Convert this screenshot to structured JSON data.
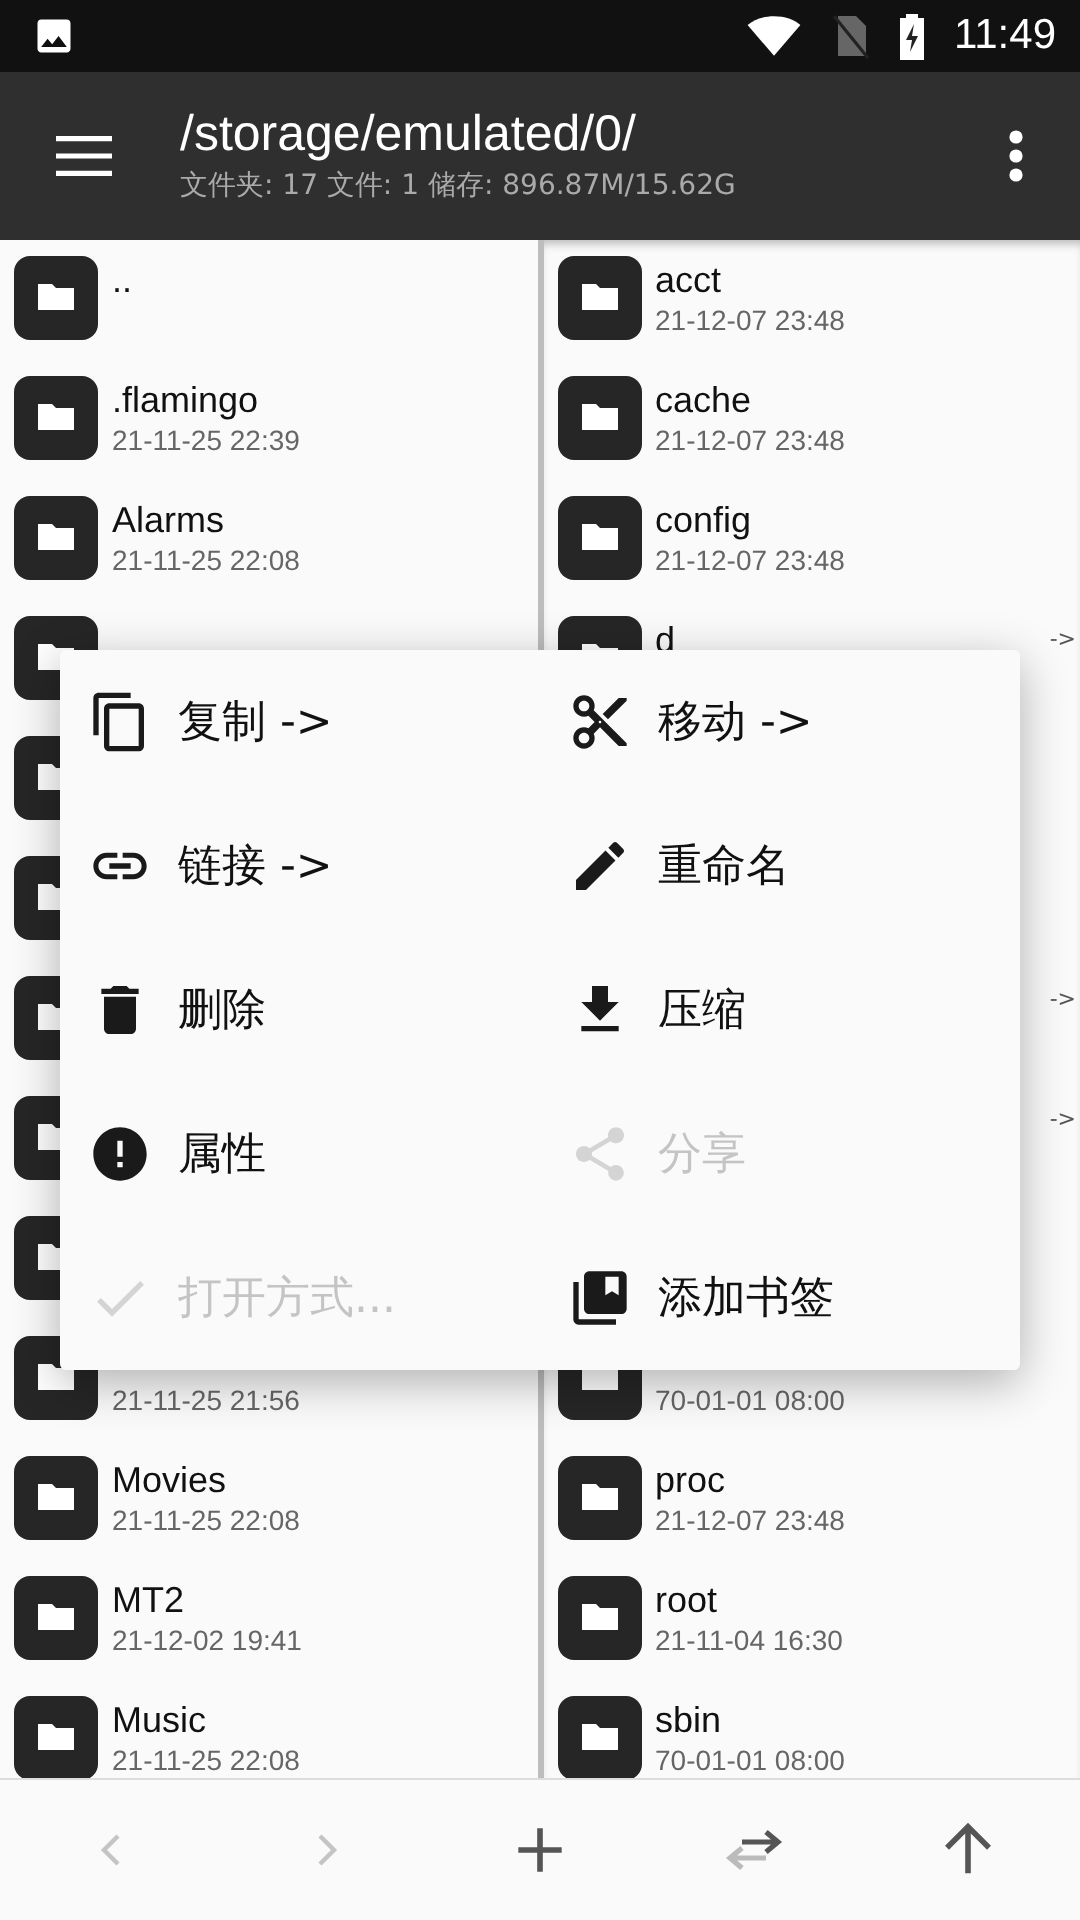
{
  "status_bar": {
    "time": "11:49"
  },
  "toolbar": {
    "title": "/storage/emulated/0/",
    "subtitle": "文件夹: 17  文件: 1  储存: 896.87M/15.62G"
  },
  "left_pane": {
    "rows": [
      {
        "name": ".."
      },
      {
        "name": ".flamingo",
        "date": "21-11-25 22:39"
      },
      {
        "name": "Alarms",
        "date": "21-11-25 22:08"
      },
      {},
      {},
      {},
      {},
      {},
      {},
      {
        "date": "21-11-25 21:56"
      },
      {
        "name": "Movies",
        "date": "21-11-25 22:08"
      },
      {
        "name": "MT2",
        "date": "21-12-02 19:41"
      },
      {
        "name": "Music",
        "date": "21-11-25 22:08"
      }
    ]
  },
  "right_pane": {
    "rows": [
      {
        "name": "acct",
        "date": "21-12-07 23:48"
      },
      {
        "name": "cache",
        "date": "21-12-07 23:48"
      },
      {
        "name": "config",
        "date": "21-12-07 23:48"
      },
      {
        "name": "d",
        "arrow": "->"
      },
      {},
      {},
      {
        "arrow": "->"
      },
      {
        "arrow": "->"
      },
      {},
      {
        "date": "70-01-01 08:00"
      },
      {
        "name": "proc",
        "date": "21-12-07 23:48"
      },
      {
        "name": "root",
        "date": "21-11-04 16:30"
      },
      {
        "name": "sbin",
        "date": "70-01-01 08:00"
      }
    ]
  },
  "context_menu": {
    "items": [
      {
        "kind": "copy",
        "label": "复制 ->",
        "disabled": false
      },
      {
        "kind": "cut",
        "label": "移动 ->",
        "disabled": false
      },
      {
        "kind": "link",
        "label": "链接 ->",
        "disabled": false
      },
      {
        "kind": "edit",
        "label": "重命名",
        "disabled": false
      },
      {
        "kind": "delete",
        "label": "删除",
        "disabled": false
      },
      {
        "kind": "download",
        "label": "压缩",
        "disabled": false
      },
      {
        "kind": "info",
        "label": "属性",
        "disabled": false
      },
      {
        "kind": "share",
        "label": "分享",
        "disabled": true
      },
      {
        "kind": "check",
        "label": "打开方式...",
        "disabled": true
      },
      {
        "kind": "bookmark",
        "label": "添加书签",
        "disabled": false
      }
    ]
  },
  "bottom_bar": {
    "buttons": [
      {
        "kind": "back",
        "disabled": true
      },
      {
        "kind": "forward",
        "disabled": true
      },
      {
        "kind": "add",
        "disabled": false
      },
      {
        "kind": "swap",
        "disabled": false
      },
      {
        "kind": "up",
        "disabled": false
      }
    ]
  }
}
